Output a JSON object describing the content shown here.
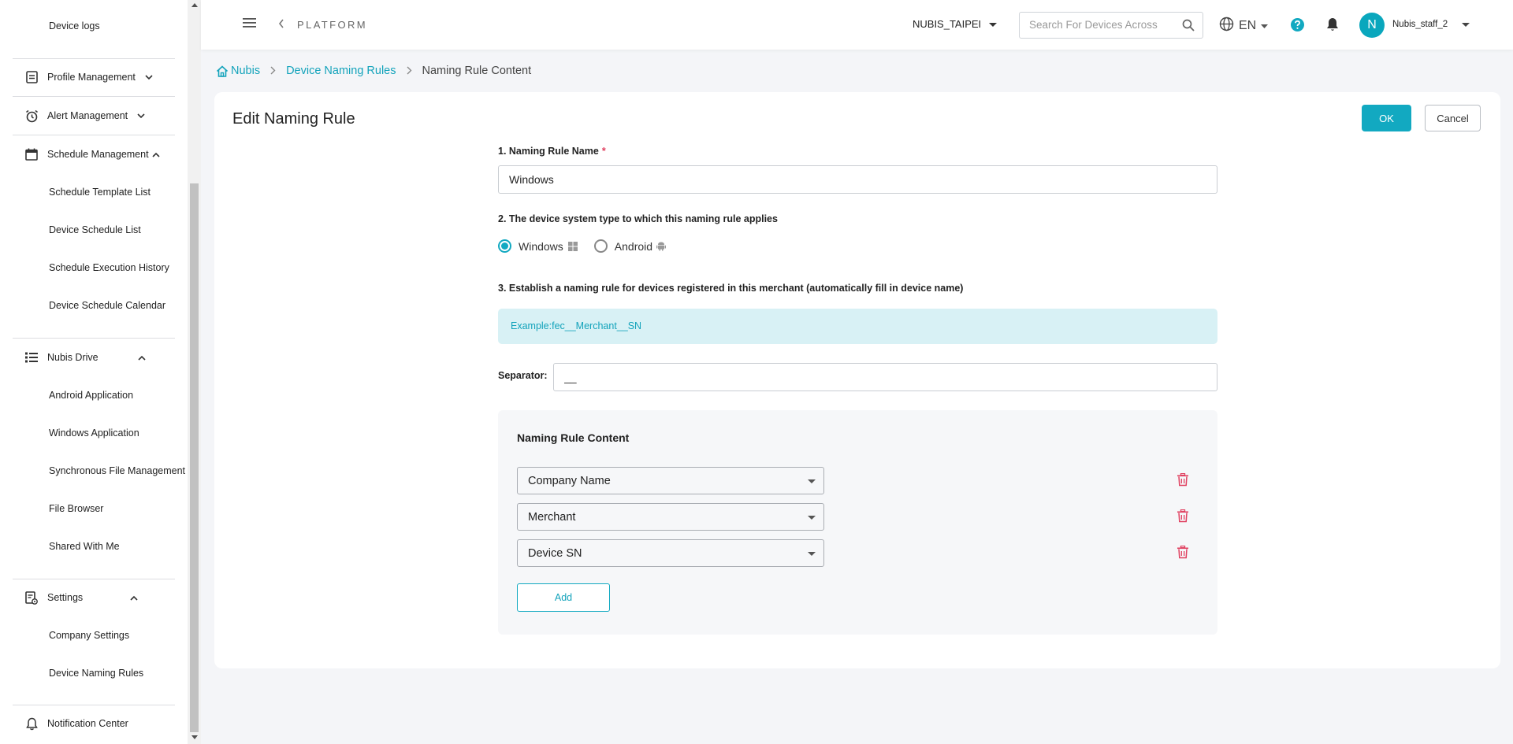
{
  "sidebar": {
    "items": {
      "device_logs": "Device logs",
      "profile_management": "Profile Management",
      "alert_management": "Alert Management",
      "schedule_management": "Schedule Management",
      "schedule_template_list": "Schedule Template List",
      "device_schedule_list": "Device Schedule List",
      "schedule_execution_history": "Schedule Execution History",
      "device_schedule_calendar": "Device Schedule Calendar",
      "nubis_drive": "Nubis Drive",
      "android_application": "Android Application",
      "windows_application": "Windows Application",
      "synchronous_file_management": "Synchronous File Management",
      "file_browser": "File Browser",
      "shared_with_me": "Shared With Me",
      "settings": "Settings",
      "company_settings": "Company Settings",
      "device_naming_rules": "Device Naming Rules",
      "notification_center": "Notification Center"
    }
  },
  "topbar": {
    "platform": "PLATFORM",
    "merchant": "NUBIS_TAIPEI",
    "search_placeholder": "Search For Devices Across",
    "language": "EN",
    "avatar_initial": "N",
    "username": "Nubis_staff_2"
  },
  "breadcrumb": {
    "home": "Nubis",
    "parent": "Device Naming Rules",
    "current": "Naming Rule Content"
  },
  "form": {
    "title": "Edit Naming Rule",
    "ok_label": "OK",
    "cancel_label": "Cancel",
    "field1_label": "1. Naming Rule Name",
    "required_mark": "*",
    "rule_name_value": "Windows",
    "field2_label": "2. The device system type to which this naming rule applies",
    "os_windows": "Windows",
    "os_android": "Android",
    "selected_os": "Windows",
    "field3_label": "3. Establish a naming rule for devices registered in this merchant (automatically fill in device name)",
    "example": "Example:fec__Merchant__SN",
    "separator_label": "Separator:",
    "separator_value": "__",
    "rule_content_title": "Naming Rule Content",
    "rule_items": [
      "Company Name",
      "Merchant",
      "Device SN"
    ],
    "add_label": "Add"
  },
  "colors": {
    "accent": "#12a9c1",
    "danger": "#e04060",
    "example_bg": "#d8f1f5"
  }
}
